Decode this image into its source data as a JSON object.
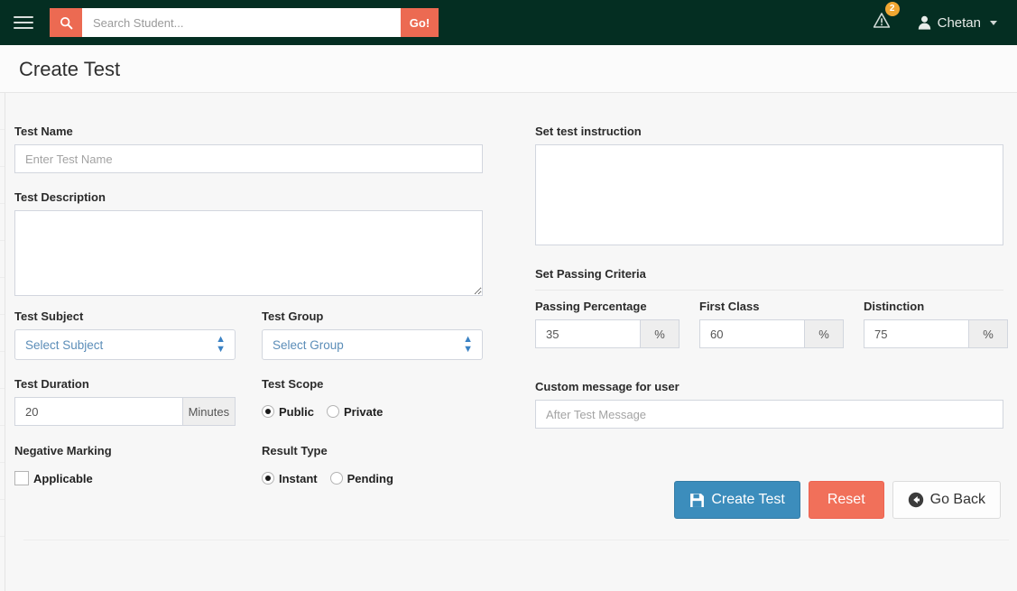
{
  "navbar": {
    "menu_icon": "hamburger-icon",
    "search": {
      "icon": "search-icon",
      "placeholder": "Search Student...",
      "value": "",
      "submit_label": "Go!"
    },
    "alerts": {
      "icon": "warning-triangle-icon",
      "badge_count": "2"
    },
    "user": {
      "icon": "user-icon",
      "name": "Chetan",
      "caret_icon": "caret-down-icon"
    }
  },
  "page": {
    "title": "Create Test"
  },
  "form": {
    "test_name": {
      "label": "Test Name",
      "placeholder": "Enter Test Name",
      "value": ""
    },
    "test_description": {
      "label": "Test Description",
      "placeholder": "",
      "value": ""
    },
    "test_subject": {
      "label": "Test Subject",
      "selected": "Select Subject"
    },
    "test_group": {
      "label": "Test Group",
      "selected": "Select Group"
    },
    "test_duration": {
      "label": "Test Duration",
      "value": "20",
      "addon": "Minutes"
    },
    "test_scope": {
      "label": "Test Scope",
      "options": [
        {
          "label": "Public",
          "selected": true
        },
        {
          "label": "Private",
          "selected": false
        }
      ]
    },
    "negative_marking": {
      "label": "Negative Marking",
      "option_label": "Applicable",
      "checked": false
    },
    "result_type": {
      "label": "Result Type",
      "options": [
        {
          "label": "Instant",
          "selected": true
        },
        {
          "label": "Pending",
          "selected": false
        }
      ]
    },
    "test_instruction": {
      "label": "Set test instruction",
      "value": ""
    },
    "passing_criteria": {
      "label": "Set Passing Criteria",
      "fields": [
        {
          "label": "Passing Percentage",
          "value": "35",
          "addon": "%"
        },
        {
          "label": "First Class",
          "value": "60",
          "addon": "%"
        },
        {
          "label": "Distinction",
          "value": "75",
          "addon": "%"
        }
      ]
    },
    "custom_message": {
      "label": "Custom message for user",
      "placeholder": "After Test Message",
      "value": ""
    }
  },
  "actions": {
    "create": {
      "label": "Create Test",
      "icon": "save-icon"
    },
    "reset": {
      "label": "Reset"
    },
    "back": {
      "label": "Go Back",
      "icon": "arrow-circle-left-icon"
    }
  },
  "colors": {
    "navbar_bg": "#042e22",
    "accent_orange": "#ec6a52",
    "badge_orange": "#f0a732",
    "primary_blue": "#3c8dbc",
    "danger_red": "#f1705a",
    "select_text_blue": "#5b8db8",
    "page_bg": "#f7f7f7"
  }
}
